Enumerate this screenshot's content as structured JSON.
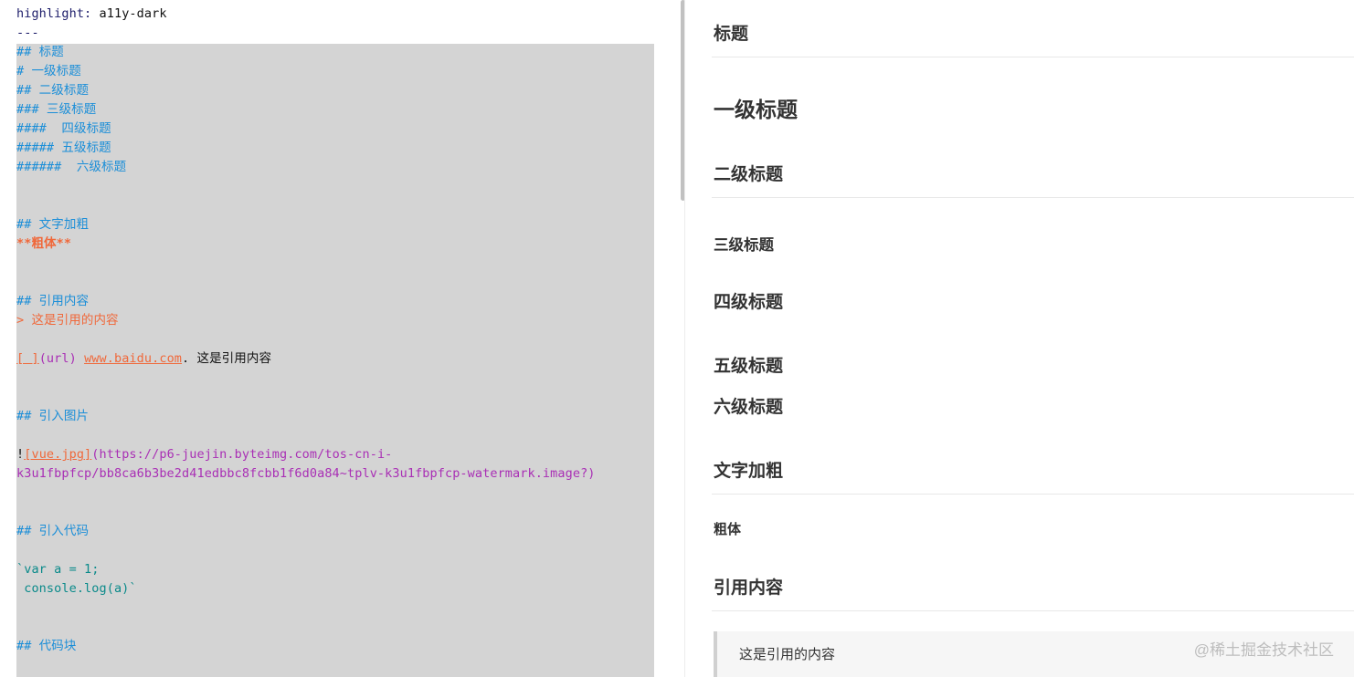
{
  "editor": {
    "lines": [
      [
        {
          "c": "c-key",
          "t": "highlight: "
        },
        {
          "c": "c-val",
          "t": "a11y-dark"
        }
      ],
      [
        {
          "c": "c-sep",
          "t": "---"
        }
      ],
      [
        {
          "c": "c-head",
          "t": "## 标题"
        }
      ],
      [
        {
          "c": "c-head",
          "t": "# 一级标题"
        }
      ],
      [
        {
          "c": "c-head",
          "t": "## 二级标题"
        }
      ],
      [
        {
          "c": "c-head",
          "t": "### 三级标题"
        }
      ],
      [
        {
          "c": "c-head",
          "t": "####  四级标题"
        }
      ],
      [
        {
          "c": "c-head",
          "t": "##### 五级标题"
        }
      ],
      [
        {
          "c": "c-head",
          "t": "######  六级标题"
        }
      ],
      [],
      [],
      [
        {
          "c": "c-head",
          "t": "## 文字加粗"
        }
      ],
      [
        {
          "c": "c-bold",
          "t": "**粗体**"
        }
      ],
      [],
      [],
      [
        {
          "c": "c-head",
          "t": "## 引用内容"
        }
      ],
      [
        {
          "c": "c-quote",
          "t": "> 这是引用的内容"
        }
      ],
      [],
      [
        {
          "c": "c-link",
          "t": "[ ]"
        },
        {
          "c": "c-paren",
          "t": "(url) "
        },
        {
          "c": "c-link",
          "t": "www.baidu.com"
        },
        {
          "c": "c-text",
          "t": ". 这是引用内容"
        }
      ],
      [],
      [],
      [
        {
          "c": "c-head",
          "t": "## 引入图片"
        }
      ],
      [],
      [
        {
          "c": "c-text",
          "t": "!"
        },
        {
          "c": "c-link",
          "t": "[vue.jpg]"
        },
        {
          "c": "c-paren",
          "t": "(https://p6-juejin.byteimg.com/tos-cn-i-"
        }
      ],
      [
        {
          "c": "c-paren",
          "t": "k3u1fbpfcp/bb8ca6b3be2d41edbbc8fcbb1f6d0a84~tplv-k3u1fbpfcp-watermark.image?)"
        }
      ],
      [],
      [],
      [
        {
          "c": "c-head",
          "t": "## 引入代码"
        }
      ],
      [],
      [
        {
          "c": "c-code",
          "t": "`var a = 1;"
        }
      ],
      [
        {
          "c": "c-code",
          "t": " console.log(a)`"
        }
      ],
      [],
      [],
      [
        {
          "c": "c-head",
          "t": "## 代码块"
        }
      ]
    ]
  },
  "preview": {
    "title": "标题",
    "h1": "一级标题",
    "h2": "二级标题",
    "h3": "三级标题",
    "h4": "四级标题",
    "h5": "五级标题",
    "h6": "六级标题",
    "bold_heading": "文字加粗",
    "bold_text": "粗体",
    "quote_heading": "引用内容",
    "quote_text": "这是引用的内容"
  },
  "watermark": "@稀土掘金技术社区"
}
